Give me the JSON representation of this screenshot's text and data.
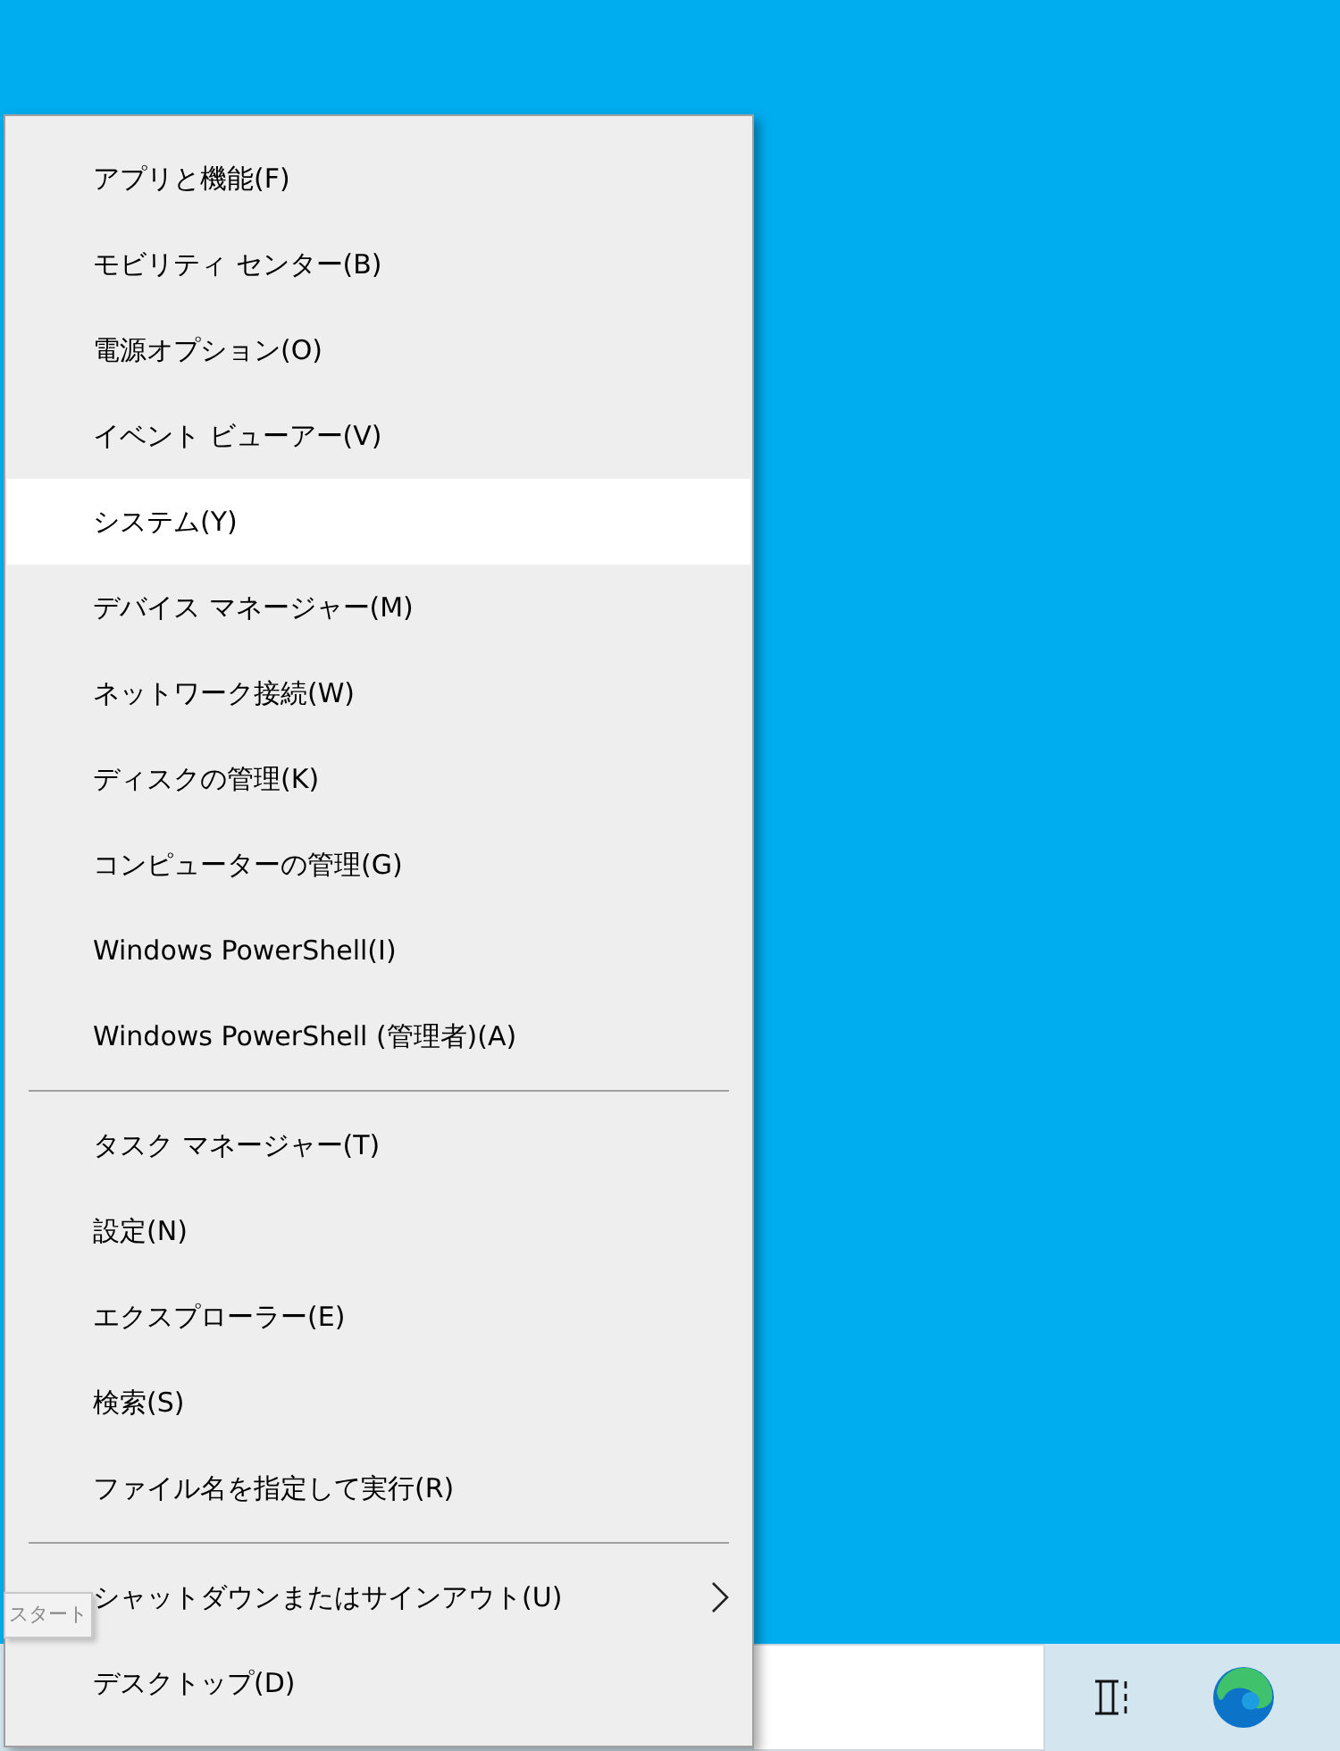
{
  "menu": {
    "groups": [
      {
        "items": [
          {
            "label": "アプリと機能(F)",
            "selected": false,
            "submenu": false
          },
          {
            "label": "モビリティ センター(B)",
            "selected": false,
            "submenu": false
          },
          {
            "label": "電源オプション(O)",
            "selected": false,
            "submenu": false
          },
          {
            "label": "イベント ビューアー(V)",
            "selected": false,
            "submenu": false
          },
          {
            "label": "システム(Y)",
            "selected": true,
            "submenu": false
          },
          {
            "label": "デバイス マネージャー(M)",
            "selected": false,
            "submenu": false
          },
          {
            "label": "ネットワーク接続(W)",
            "selected": false,
            "submenu": false
          },
          {
            "label": "ディスクの管理(K)",
            "selected": false,
            "submenu": false
          },
          {
            "label": "コンピューターの管理(G)",
            "selected": false,
            "submenu": false
          },
          {
            "label": "Windows PowerShell(I)",
            "selected": false,
            "submenu": false
          },
          {
            "label": "Windows PowerShell (管理者)(A)",
            "selected": false,
            "submenu": false
          }
        ]
      },
      {
        "items": [
          {
            "label": "タスク マネージャー(T)",
            "selected": false,
            "submenu": false
          },
          {
            "label": "設定(N)",
            "selected": false,
            "submenu": false
          },
          {
            "label": "エクスプローラー(E)",
            "selected": false,
            "submenu": false
          },
          {
            "label": "検索(S)",
            "selected": false,
            "submenu": false
          },
          {
            "label": "ファイル名を指定して実行(R)",
            "selected": false,
            "submenu": false
          }
        ]
      },
      {
        "items": [
          {
            "label": "シャットダウンまたはサインアウト(U)",
            "selected": false,
            "submenu": true
          },
          {
            "label": "デスクトップ(D)",
            "selected": false,
            "submenu": false
          }
        ]
      }
    ]
  },
  "tooltip": {
    "text": "スタート"
  }
}
